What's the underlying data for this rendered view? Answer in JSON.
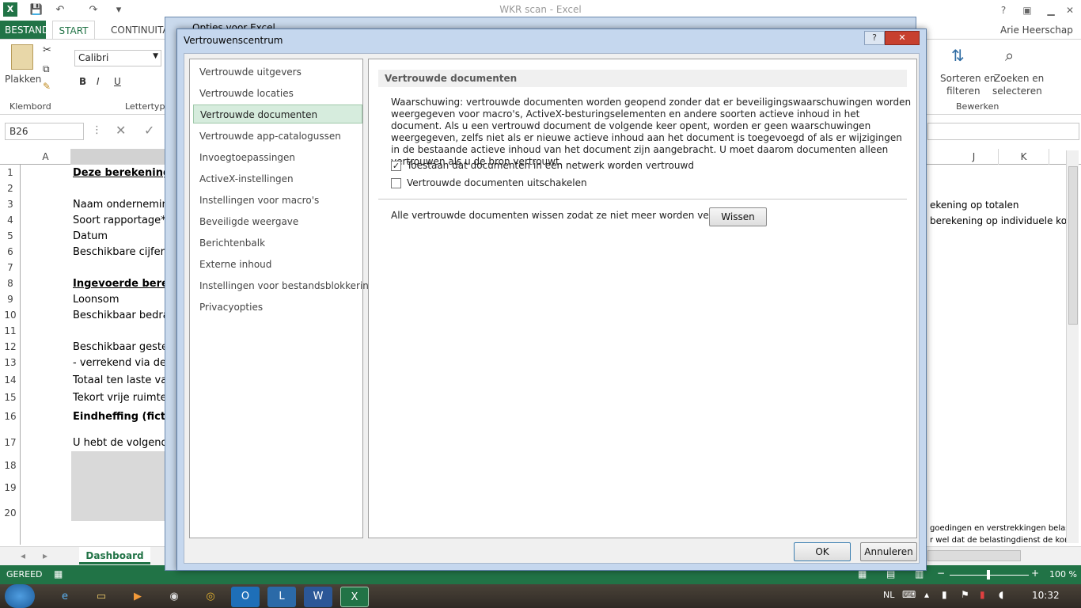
{
  "window": {
    "title": "WKR scan - Excel",
    "user": "Arie Heerschap"
  },
  "tabs": {
    "file": "BESTAND",
    "start": "START",
    "continuation": "CONTINUITA"
  },
  "ribbon": {
    "paste": "Plakken",
    "clipboard": "Klembord",
    "font_name": "Calibri",
    "font_group": "Lettertype",
    "bold": "B",
    "italic": "I",
    "underline": "U",
    "sort_line1": "Sorteren en",
    "sort_line2": "filteren",
    "find_line1": "Zoeken en",
    "find_line2": "selecteren",
    "edit_group": "Bewerken"
  },
  "formula": {
    "namebox": "B26"
  },
  "columns": [
    "A",
    "J",
    "K"
  ],
  "rows": [
    "1",
    "2",
    "3",
    "4",
    "5",
    "6",
    "7",
    "8",
    "9",
    "10",
    "11",
    "12",
    "13",
    "14",
    "15",
    "16",
    "17",
    "18",
    "19",
    "20"
  ],
  "cells": {
    "r1": "Deze berekening w",
    "r3": "Naam ondernemin",
    "r4": "Soort rapportage*",
    "r5": "Datum",
    "r6": "Beschikbare cijfers",
    "r8": "Ingevoerde bereke",
    "r9": "Loonsom",
    "r10": "Beschikbaar bedrag",
    "r12": "Beschikbaar gestel",
    "r13": "- verrekend via de",
    "r14": "Totaal ten laste var",
    "r15": "Tekort vrije ruimte",
    "r16": "Eindheffing (fictief",
    "r17": "U hebt de volgende",
    "right3": "ekening op totalen",
    "right4": "berekening op individuele kost",
    "right20a": "goedingen en verstrekkingen belasti",
    "right20b": "r wel dat de belastingdienst de kome"
  },
  "sheet": {
    "tab": "Dashboard"
  },
  "status": {
    "ready": "GEREED",
    "zoom": "100 %"
  },
  "taskbar": {
    "lang": "NL",
    "time": "10:32"
  },
  "options_dialog": {
    "title": "Opties voor Excel"
  },
  "dialog": {
    "title": "Vertrouwenscentrum",
    "help": "?",
    "close": "✕",
    "nav": [
      "Vertrouwde uitgevers",
      "Vertrouwde locaties",
      "Vertrouwde documenten",
      "Vertrouwde app-catalogussen",
      "Invoegtoepassingen",
      "ActiveX-instellingen",
      "Instellingen voor macro's",
      "Beveiligde weergave",
      "Berichtenbalk",
      "Externe inhoud",
      "Instellingen voor bestandsblokkering",
      "Privacyopties"
    ],
    "selected_index": 2,
    "section_title": "Vertrouwde documenten",
    "warning": "Waarschuwing: vertrouwde documenten worden geopend zonder dat er beveiligingswaarschuwingen worden weergegeven voor macro's, ActiveX-besturingselementen en andere soorten actieve inhoud in het document. Als u een vertrouwd document de volgende keer opent, worden er geen waarschuwingen weergegeven, zelfs niet als er nieuwe actieve inhoud aan het document is toegevoegd of als er wijzigingen in de bestaande actieve inhoud van het document zijn aangebracht. U moet daarom documenten alleen vertrouwen als u de bron vertrouwt.",
    "checkbox1": {
      "label": "Toestaan dat documenten in een netwerk worden vertrouwd",
      "checked": true
    },
    "checkbox2": {
      "label": "Vertrouwde documenten uitschakelen",
      "checked": false
    },
    "clear_text": "Alle vertrouwde documenten wissen zodat ze niet meer worden vertrouwd",
    "clear_button": "Wissen",
    "ok": "OK",
    "cancel": "Annuleren"
  },
  "colors": {
    "excel_green": "#217346",
    "selected_nav": "#d6ecdd",
    "dialog_frame": "#c5d7ee"
  }
}
